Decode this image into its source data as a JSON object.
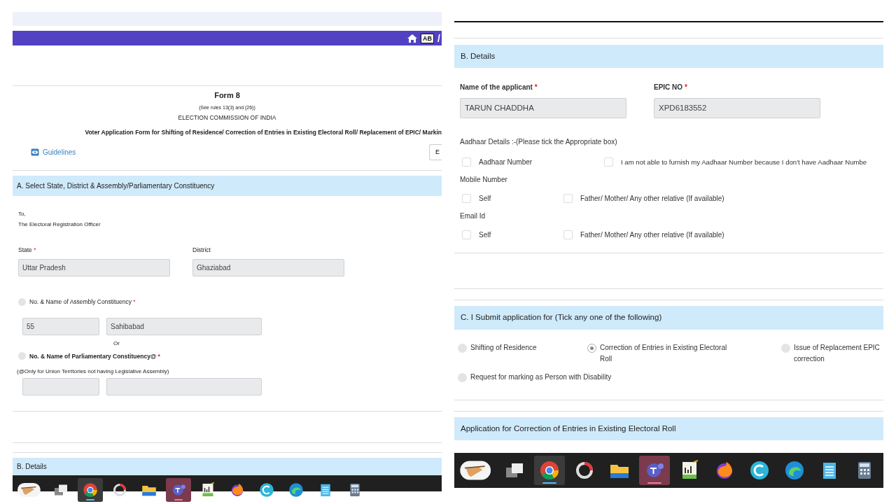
{
  "left_panel": {
    "nav": {
      "badge": "AB",
      "separator": "/"
    },
    "form_header": {
      "title": "Form 8",
      "rules": "(See rules 13(3) and (26))",
      "authority": "ELECTION COMMISSION OF INDIA",
      "subtitle": "Voter Application Form for Shifting of Residence/ Correction of Entries in Existing Electoral Roll/ Replacement of EPIC/ Markin",
      "guidelines": "Guidelines",
      "cut_button": "E"
    },
    "section_a": {
      "heading": "A. Select State, District & Assembly/Parliamentary Constituency",
      "address": [
        "To,",
        "The Electoral Registration Officer"
      ],
      "fields": [
        {
          "label": "State",
          "required_mark": "*",
          "value": "Uttar Pradesh"
        },
        {
          "label": "District",
          "value": "Ghaziabad"
        }
      ],
      "assembly": {
        "label": "No. & Name of Assembly Constituency",
        "required_mark": "*",
        "selected": false,
        "number": "55",
        "name": "Sahibabad"
      },
      "or_text": "Or",
      "parliamentary": {
        "label": "No. & Name of Parliamentary Constituency@",
        "required_mark": "*",
        "selected": false,
        "note": "(@Only for Union Territories not having Legislative Assembly)"
      }
    },
    "next_heading": "B. Details",
    "taskbar": [
      {
        "kind": "pen",
        "selected": false
      },
      {
        "kind": "squares",
        "selected": false
      },
      {
        "kind": "chrome",
        "selected": true
      },
      {
        "kind": "ring",
        "selected": false
      },
      {
        "kind": "folder",
        "selected": false
      },
      {
        "kind": "teams",
        "selected": true
      },
      {
        "kind": "chartdoc",
        "selected": false
      },
      {
        "kind": "flame",
        "selected": false
      },
      {
        "kind": "carc",
        "selected": false
      },
      {
        "kind": "swirl",
        "selected": false
      },
      {
        "kind": "notepad",
        "selected": false
      },
      {
        "kind": "calculator",
        "selected": false
      }
    ]
  },
  "right_panel": {
    "section_b": {
      "heading": "B. Details",
      "fields": [
        {
          "label": "Name of the applicant",
          "required_mark": "*",
          "value": "TARUN CHADDHA"
        },
        {
          "label": "EPIC NO",
          "required_mark": "*",
          "value": "XPD6183552"
        }
      ],
      "groups": [
        {
          "label": "Aadhaar Details :-(Please tick the Appropriate box)",
          "options": [
            {
              "label": "Aadhaar Number",
              "checked": false
            },
            {
              "label": "I am not able to furnish my Aadhaar Number because I don't have Aadhaar Numbe",
              "checked": false
            }
          ]
        },
        {
          "label": "Mobile Number",
          "options": [
            {
              "label": "Self",
              "checked": false
            },
            {
              "label": "Father/ Mother/ Any other relative (If available)",
              "checked": false
            }
          ]
        },
        {
          "label": "Email Id",
          "options": [
            {
              "label": "Self",
              "checked": false
            },
            {
              "label": "Father/ Mother/ Any other relative (If available)",
              "checked": false
            }
          ]
        }
      ]
    },
    "section_c": {
      "heading": "C. I Submit application for (Tick any one of the following)",
      "options": [
        {
          "label": "Shifting of Residence",
          "selected": false
        },
        {
          "label": "Correction of Entries in Existing Electoral Roll",
          "selected": true
        },
        {
          "label": "Issue of Replacement EPIC correction",
          "selected": false
        },
        {
          "label": "Request for marking as Person with Disability",
          "selected": false
        }
      ]
    },
    "next_heading": "Application for Correction of Entries in Existing Electoral Roll",
    "taskbar": [
      {
        "kind": "pen",
        "selected": false
      },
      {
        "kind": "squares",
        "selected": false
      },
      {
        "kind": "chrome",
        "selected": true
      },
      {
        "kind": "ring",
        "selected": false
      },
      {
        "kind": "folder",
        "selected": false
      },
      {
        "kind": "teams",
        "selected": true
      },
      {
        "kind": "chartdoc",
        "selected": false
      },
      {
        "kind": "flame",
        "selected": false
      },
      {
        "kind": "carc",
        "selected": false
      },
      {
        "kind": "swirl",
        "selected": false
      },
      {
        "kind": "notepad",
        "selected": false
      },
      {
        "kind": "calculator",
        "selected": false
      }
    ]
  }
}
